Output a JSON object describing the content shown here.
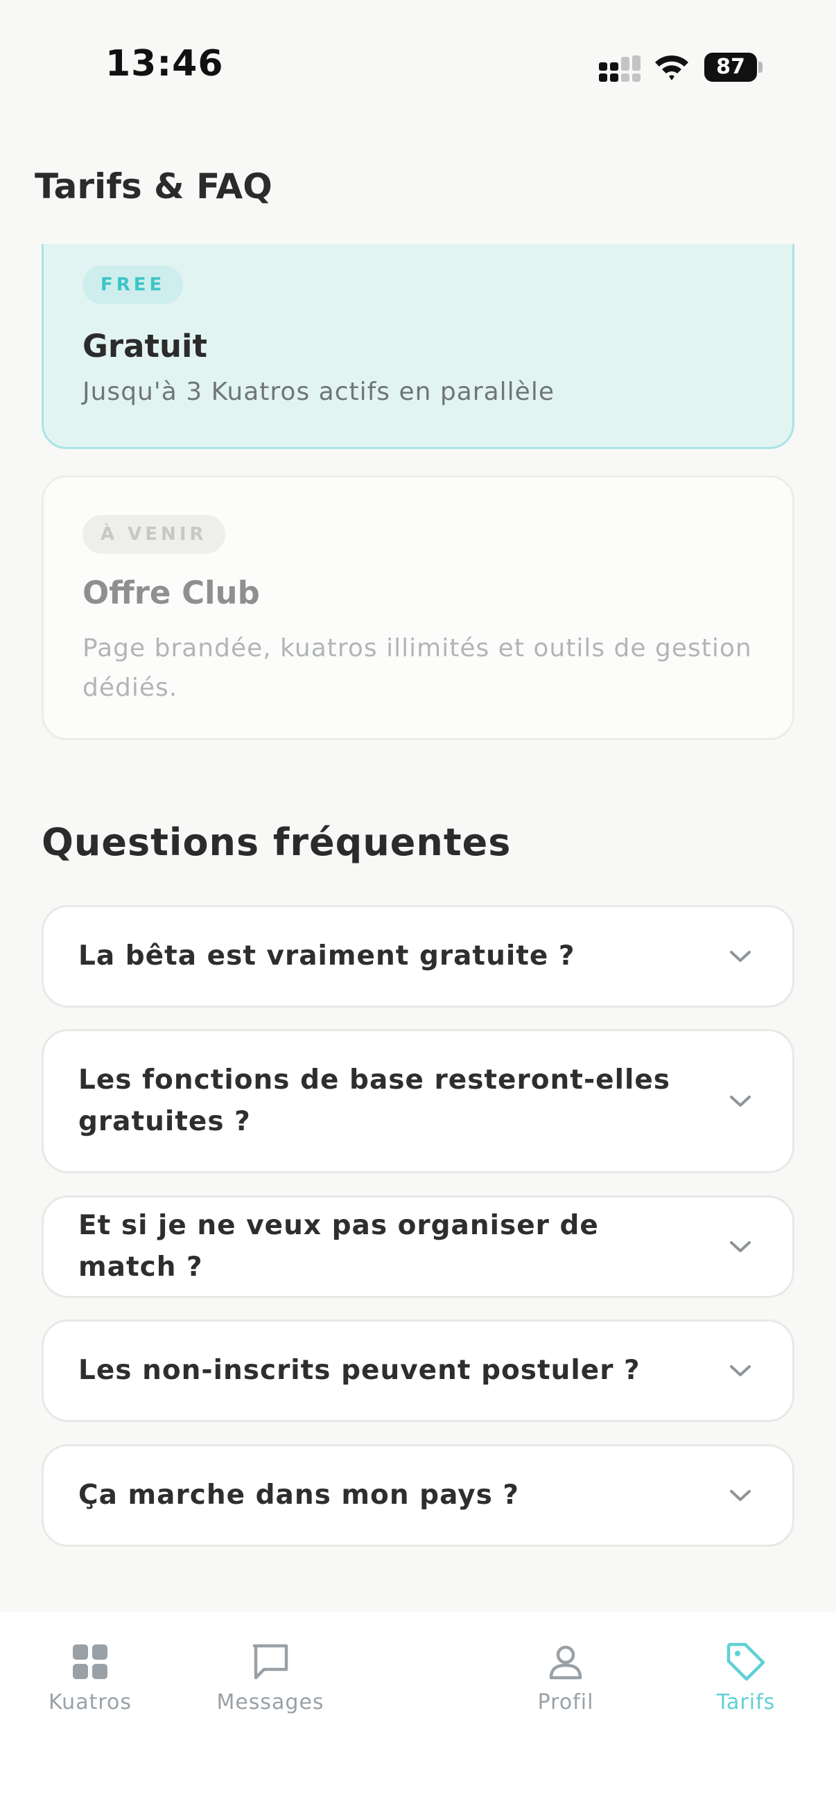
{
  "status_bar": {
    "time": "13:46",
    "battery": "87"
  },
  "header": {
    "title": "Tarifs & FAQ"
  },
  "plans": [
    {
      "badge": "FREE",
      "name": "Gratuit",
      "description": "Jusqu'à 3 Kuatros actifs en parallèle"
    },
    {
      "badge": "À VENIR",
      "name": "Offre Club",
      "description": "Page brandée, kuatros illimités et outils de gestion dédiés."
    }
  ],
  "faq": {
    "heading": "Questions fréquentes",
    "items": [
      {
        "question": "La bêta est vraiment gratuite ?"
      },
      {
        "question": "Les fonctions de base resteront-elles gratuites ?"
      },
      {
        "question": "Et si je ne veux pas organiser de match ?"
      },
      {
        "question": "Les non-inscrits peuvent postuler ?"
      },
      {
        "question": "Ça marche dans mon pays ?"
      }
    ]
  },
  "nav": {
    "items": [
      {
        "label": "Kuatros",
        "icon": "grid-icon"
      },
      {
        "label": "Messages",
        "icon": "message-icon"
      },
      {
        "label": "Profil",
        "icon": "person-icon"
      },
      {
        "label": "Tarifs",
        "icon": "tag-icon",
        "active": true
      }
    ]
  },
  "colors": {
    "accent": "#5fd0d6",
    "free_card_bg": "#e2f4f1",
    "inactive_nav": "#9aa1a6"
  }
}
